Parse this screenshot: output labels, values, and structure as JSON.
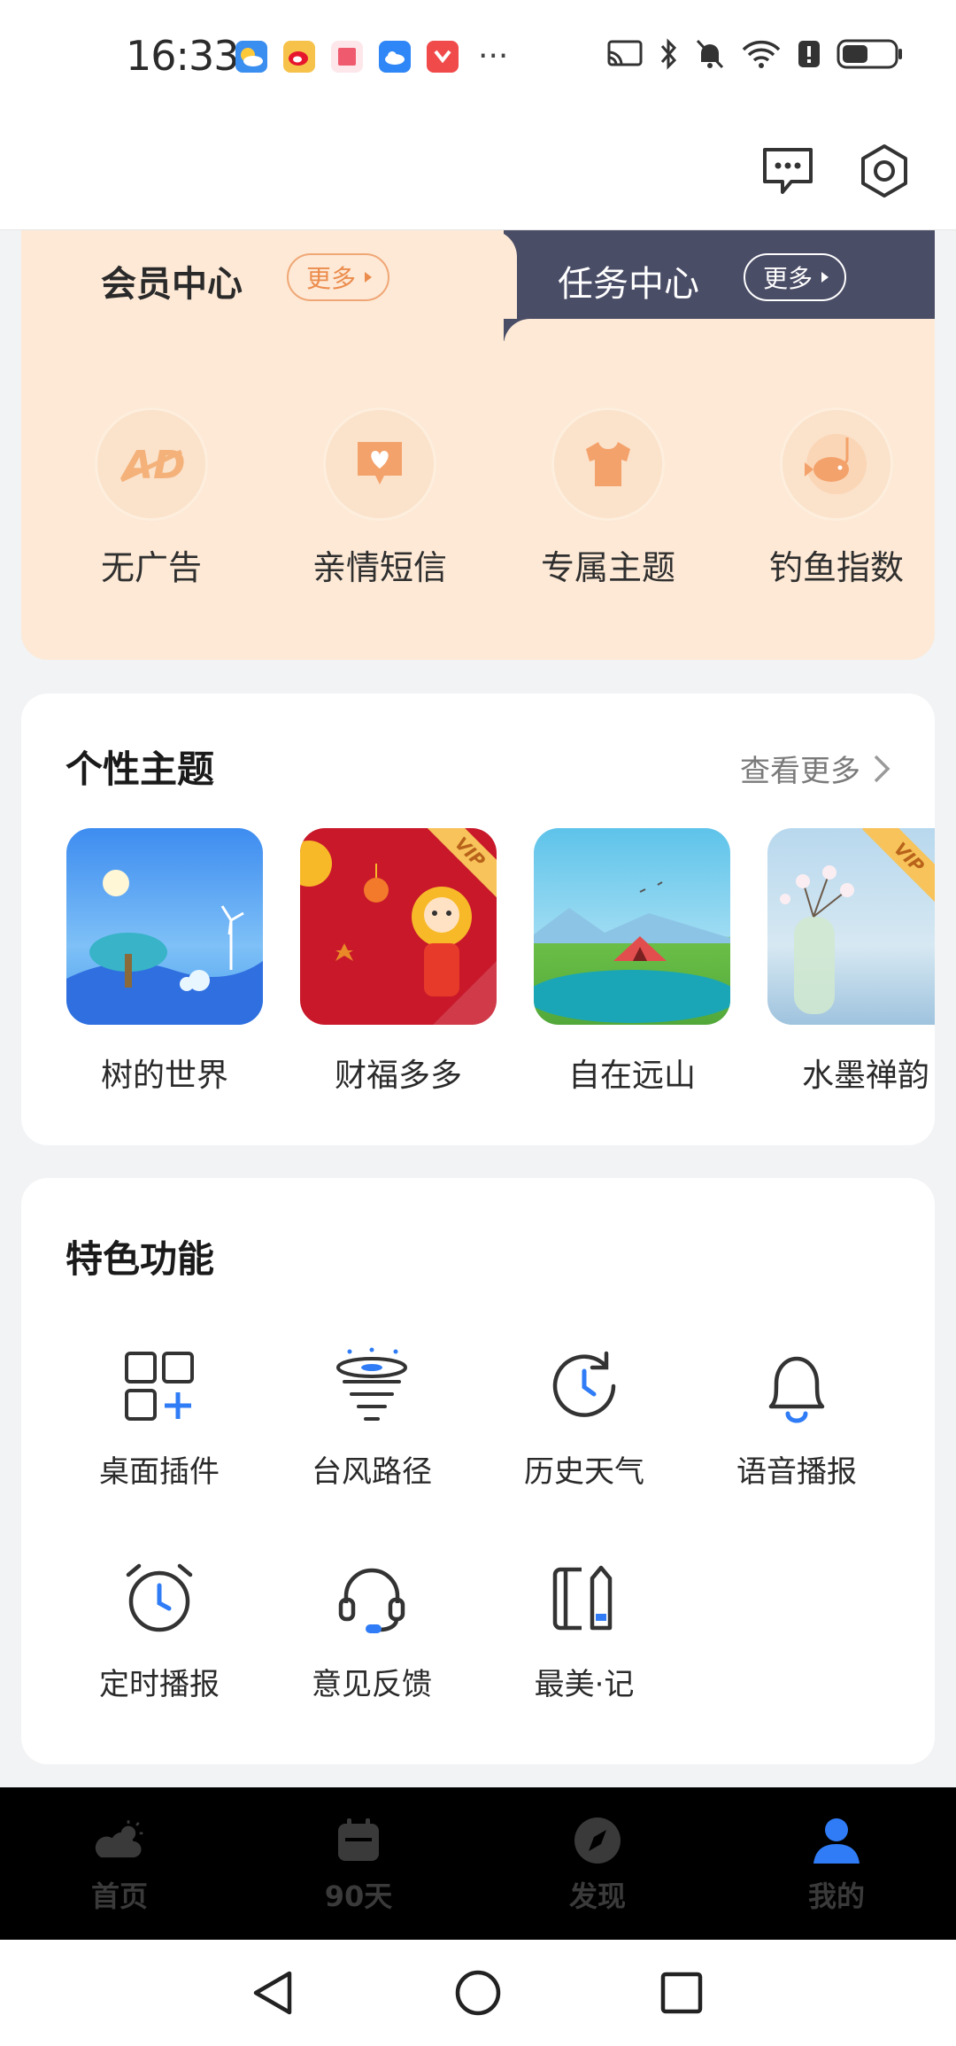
{
  "status_bar": {
    "time": "16:33",
    "notification_icons": [
      "weather-app-icon",
      "weibo-icon",
      "book-app-icon",
      "cloud-app-icon",
      "red-app-icon"
    ],
    "overflow": "···",
    "system_icons": [
      "cast-icon",
      "bluetooth-icon",
      "mute-icon",
      "wifi-icon",
      "alert-icon",
      "battery-icon"
    ]
  },
  "header": {
    "icons": [
      "message-icon",
      "settings-icon"
    ]
  },
  "member_card": {
    "member_tab": "会员中心",
    "member_more": "更多",
    "task_tab": "任务中心",
    "task_more": "更多",
    "perks": [
      {
        "label": "无广告",
        "icon": "no-ad-icon"
      },
      {
        "label": "亲情短信",
        "icon": "heart-message-icon"
      },
      {
        "label": "专属主题",
        "icon": "tshirt-icon"
      },
      {
        "label": "钓鱼指数",
        "icon": "fishing-icon"
      }
    ],
    "colors": {
      "accent": "#ec8c4c",
      "background": "#fde9d6",
      "task_bg": "#4a4d66"
    }
  },
  "themes": {
    "title": "个性主题",
    "see_more": "查看更多",
    "items": [
      {
        "label": "树的世界",
        "vip": false
      },
      {
        "label": "财福多多",
        "vip": true,
        "badge": "VIP"
      },
      {
        "label": "自在远山",
        "vip": false
      },
      {
        "label": "水墨禅韵",
        "vip": true,
        "badge": "VIP"
      }
    ]
  },
  "features": {
    "title": "特色功能",
    "items": [
      {
        "label": "桌面插件",
        "icon": "widget-add-icon"
      },
      {
        "label": "台风路径",
        "icon": "typhoon-icon"
      },
      {
        "label": "历史天气",
        "icon": "history-clock-icon"
      },
      {
        "label": "语音播报",
        "icon": "bell-icon"
      },
      {
        "label": "定时播报",
        "icon": "alarm-clock-icon"
      },
      {
        "label": "意见反馈",
        "icon": "headset-icon"
      },
      {
        "label": "最美·记",
        "icon": "notebook-icon"
      }
    ],
    "accent": "#2f7cf6"
  },
  "bottom_nav": {
    "items": [
      {
        "label": "首页",
        "icon": "weather-home-icon",
        "active": false
      },
      {
        "label": "90天",
        "icon": "calendar-icon",
        "active": false
      },
      {
        "label": "发现",
        "icon": "compass-icon",
        "active": false
      },
      {
        "label": "我的",
        "icon": "person-icon",
        "active": true
      }
    ],
    "active_color": "#2f7cf6"
  },
  "system_nav": {
    "icons": [
      "back-icon",
      "home-icon",
      "recents-icon"
    ]
  }
}
